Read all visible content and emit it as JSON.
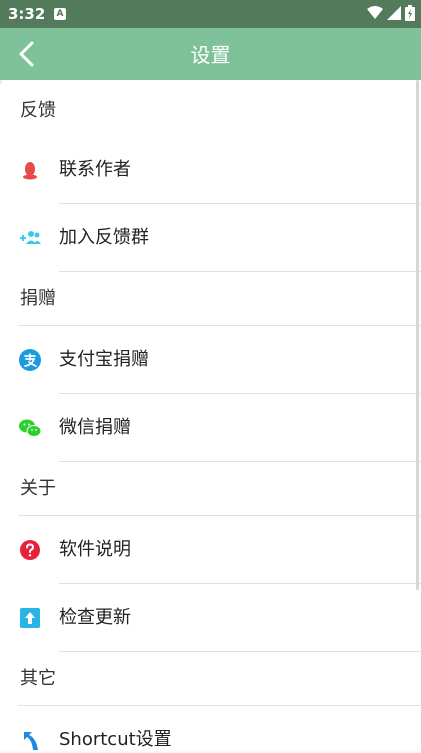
{
  "status_bar": {
    "time": "3:32",
    "notification_letter": "A"
  },
  "app_bar": {
    "title": "设置"
  },
  "sections": {
    "feedback": {
      "title": "反馈",
      "items": [
        {
          "label": "联系作者",
          "icon": "qq-penguin-icon"
        },
        {
          "label": "加入反馈群",
          "icon": "add-group-icon"
        }
      ]
    },
    "donate": {
      "title": "捐赠",
      "items": [
        {
          "label": "支付宝捐赠",
          "icon": "alipay-icon"
        },
        {
          "label": "微信捐赠",
          "icon": "wechat-icon"
        }
      ]
    },
    "about": {
      "title": "关于",
      "items": [
        {
          "label": "软件说明",
          "icon": "help-icon"
        },
        {
          "label": "检查更新",
          "icon": "update-icon"
        }
      ]
    },
    "other": {
      "title": "其它",
      "items": [
        {
          "label": "Shortcut设置",
          "icon": "shortcut-arrow-icon"
        }
      ]
    }
  },
  "colors": {
    "status_bar": "#547a5c",
    "app_bar": "#7fc199",
    "qq_red": "#e84a4a",
    "group_cyan": "#3cc8e8",
    "alipay_blue": "#1a9ae0",
    "wechat_green": "#2cd02c",
    "help_red": "#e8203c",
    "update_cyan": "#2ab4e6",
    "shortcut_blue": "#1e88e5"
  }
}
